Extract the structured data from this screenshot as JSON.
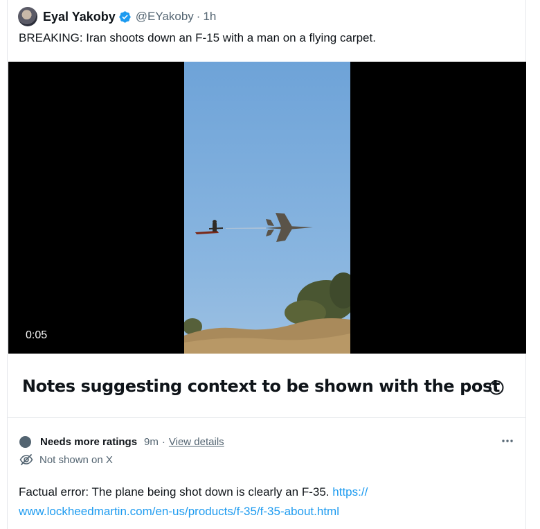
{
  "post": {
    "author_name": "Eyal Yakoby",
    "handle": "@EYakoby",
    "separator": "·",
    "time": "1h",
    "text": "BREAKING: Iran shoots down an F-15 with a man on a flying carpet.",
    "verified_icon": "verified-badge-icon",
    "verified_color": "#1d9bf0"
  },
  "media": {
    "type": "video",
    "duration": "0:05"
  },
  "notes_section": {
    "title": "Notes suggesting context to be shown with the post",
    "info_icon": "info-icon"
  },
  "note": {
    "status": "Needs more ratings",
    "time": "9m",
    "separator": "·",
    "view_details": "View details",
    "visibility": "Not shown on X",
    "text": "Factual error: The plane being shot down is clearly an F-35. ",
    "link": "https://www.lockheedmartin.com/en-us/products/f-35/f-35-about.html",
    "link_line1": "https://",
    "link_line2": "www.lockheedmartin.com/en-us/products/f-35/f-35-about.html",
    "link_color": "#1d9bf0",
    "status_color": "#536471"
  }
}
